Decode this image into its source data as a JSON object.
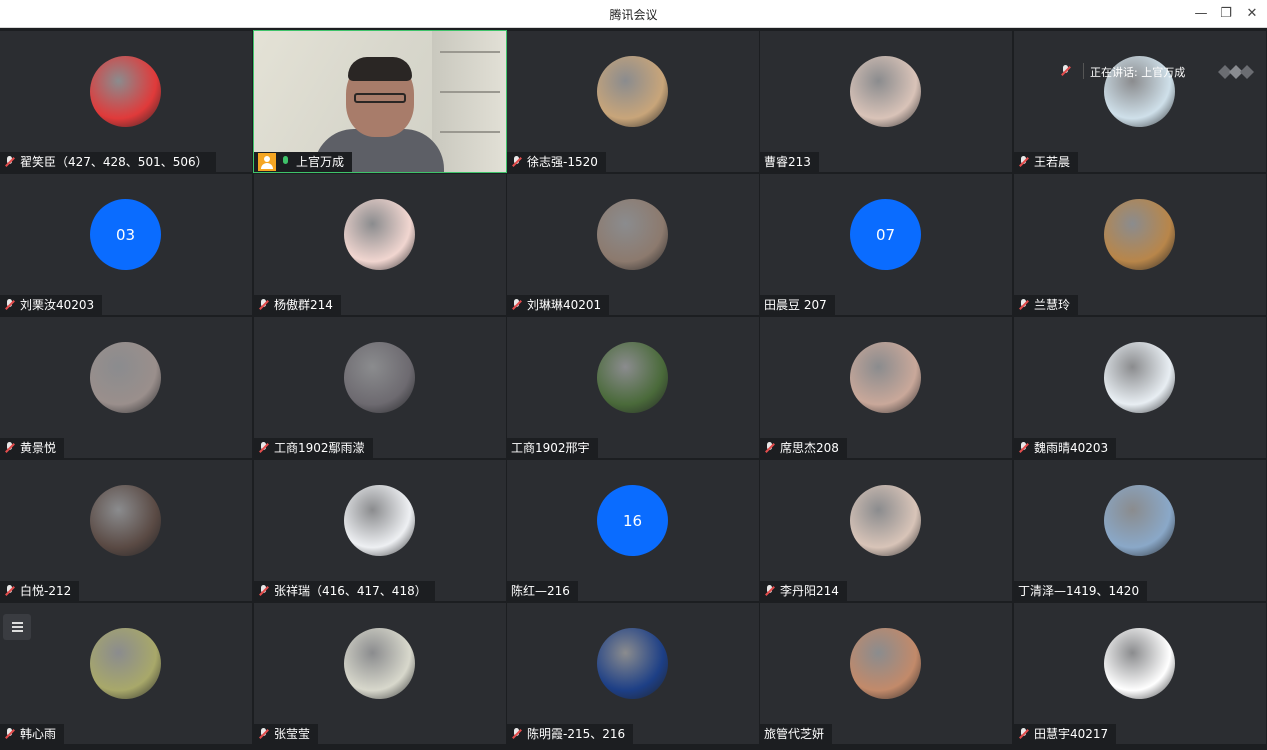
{
  "window": {
    "title": "腾讯会议",
    "controls": [
      "minimize-icon",
      "restore-icon",
      "close-icon"
    ]
  },
  "speaking_indicator": {
    "text": "正在讲话: 上官万成"
  },
  "participants": [
    {
      "name": "翟笑臣（427、428、501、506）",
      "muted": true,
      "avatar": "gintoki-cartoon",
      "color": "#e03a3a"
    },
    {
      "name": "上官万成",
      "muted": false,
      "video": true,
      "host": true
    },
    {
      "name": "徐志强-1520",
      "muted": true,
      "avatar": "teddy-bear",
      "color": "#c8a57a"
    },
    {
      "name": "曹睿213",
      "muted": false,
      "avatar": "girl-photo",
      "color": "#d9c3b8"
    },
    {
      "name": "王若晨",
      "muted": true,
      "avatar": "sky-photo",
      "color": "#cfe0ea"
    },
    {
      "name": "刘栗汝40203",
      "muted": true,
      "avatar_text": "03",
      "color": "#0a6cff"
    },
    {
      "name": "杨傲群214",
      "muted": true,
      "avatar": "bunny-drawing",
      "color": "#f1d6d0"
    },
    {
      "name": "刘琳琳40201",
      "muted": true,
      "avatar": "cat-photo",
      "color": "#8c7a6e"
    },
    {
      "name": "田晨豆 207",
      "muted": false,
      "avatar_text": "07",
      "color": "#0a6cff"
    },
    {
      "name": "兰慧玲",
      "muted": true,
      "avatar": "dog-photo",
      "color": "#b8864a"
    },
    {
      "name": "黄景悦",
      "muted": true,
      "avatar": "girl-photo",
      "color": "#9a8f8c"
    },
    {
      "name": "工商1902鄢雨濛",
      "muted": true,
      "avatar": "cat-photo",
      "color": "#6d6a70"
    },
    {
      "name": "工商1902邢宇",
      "muted": false,
      "avatar": "tires-photo",
      "color": "#4a6a3a"
    },
    {
      "name": "席思杰208",
      "muted": true,
      "avatar": "baby-photo",
      "color": "#c9a89a"
    },
    {
      "name": "魏雨晴40203",
      "muted": true,
      "avatar": "girl-hat-photo",
      "color": "#e8eef3"
    },
    {
      "name": "白悦-212",
      "muted": true,
      "avatar": "dark-photo",
      "color": "#5a4a44"
    },
    {
      "name": "张祥瑞（416、417、418）",
      "muted": true,
      "avatar": "anime-drawing",
      "color": "#eef0f3"
    },
    {
      "name": "陈红—216",
      "muted": false,
      "avatar_text": "16",
      "color": "#0a6cff"
    },
    {
      "name": "李丹阳214",
      "muted": true,
      "avatar": "child-photo",
      "color": "#d8c4b8"
    },
    {
      "name": "丁清泽—1419、1420",
      "muted": false,
      "avatar": "anime-boy",
      "color": "#8aa8c8"
    },
    {
      "name": "韩心雨",
      "muted": true,
      "avatar": "girl-photo",
      "color": "#a8a86a"
    },
    {
      "name": "张莹莹",
      "muted": true,
      "avatar": "girl-photo",
      "color": "#d8d8cc"
    },
    {
      "name": "陈明霞-215、216",
      "muted": true,
      "avatar": "night-sky",
      "color": "#1d3f86"
    },
    {
      "name": "旅管代芝妍",
      "muted": false,
      "avatar": "girl-santa-hat",
      "color": "#c28a6a"
    },
    {
      "name": "田慧宇40217",
      "muted": true,
      "avatar": "drawing-white",
      "color": "#ffffff"
    }
  ]
}
